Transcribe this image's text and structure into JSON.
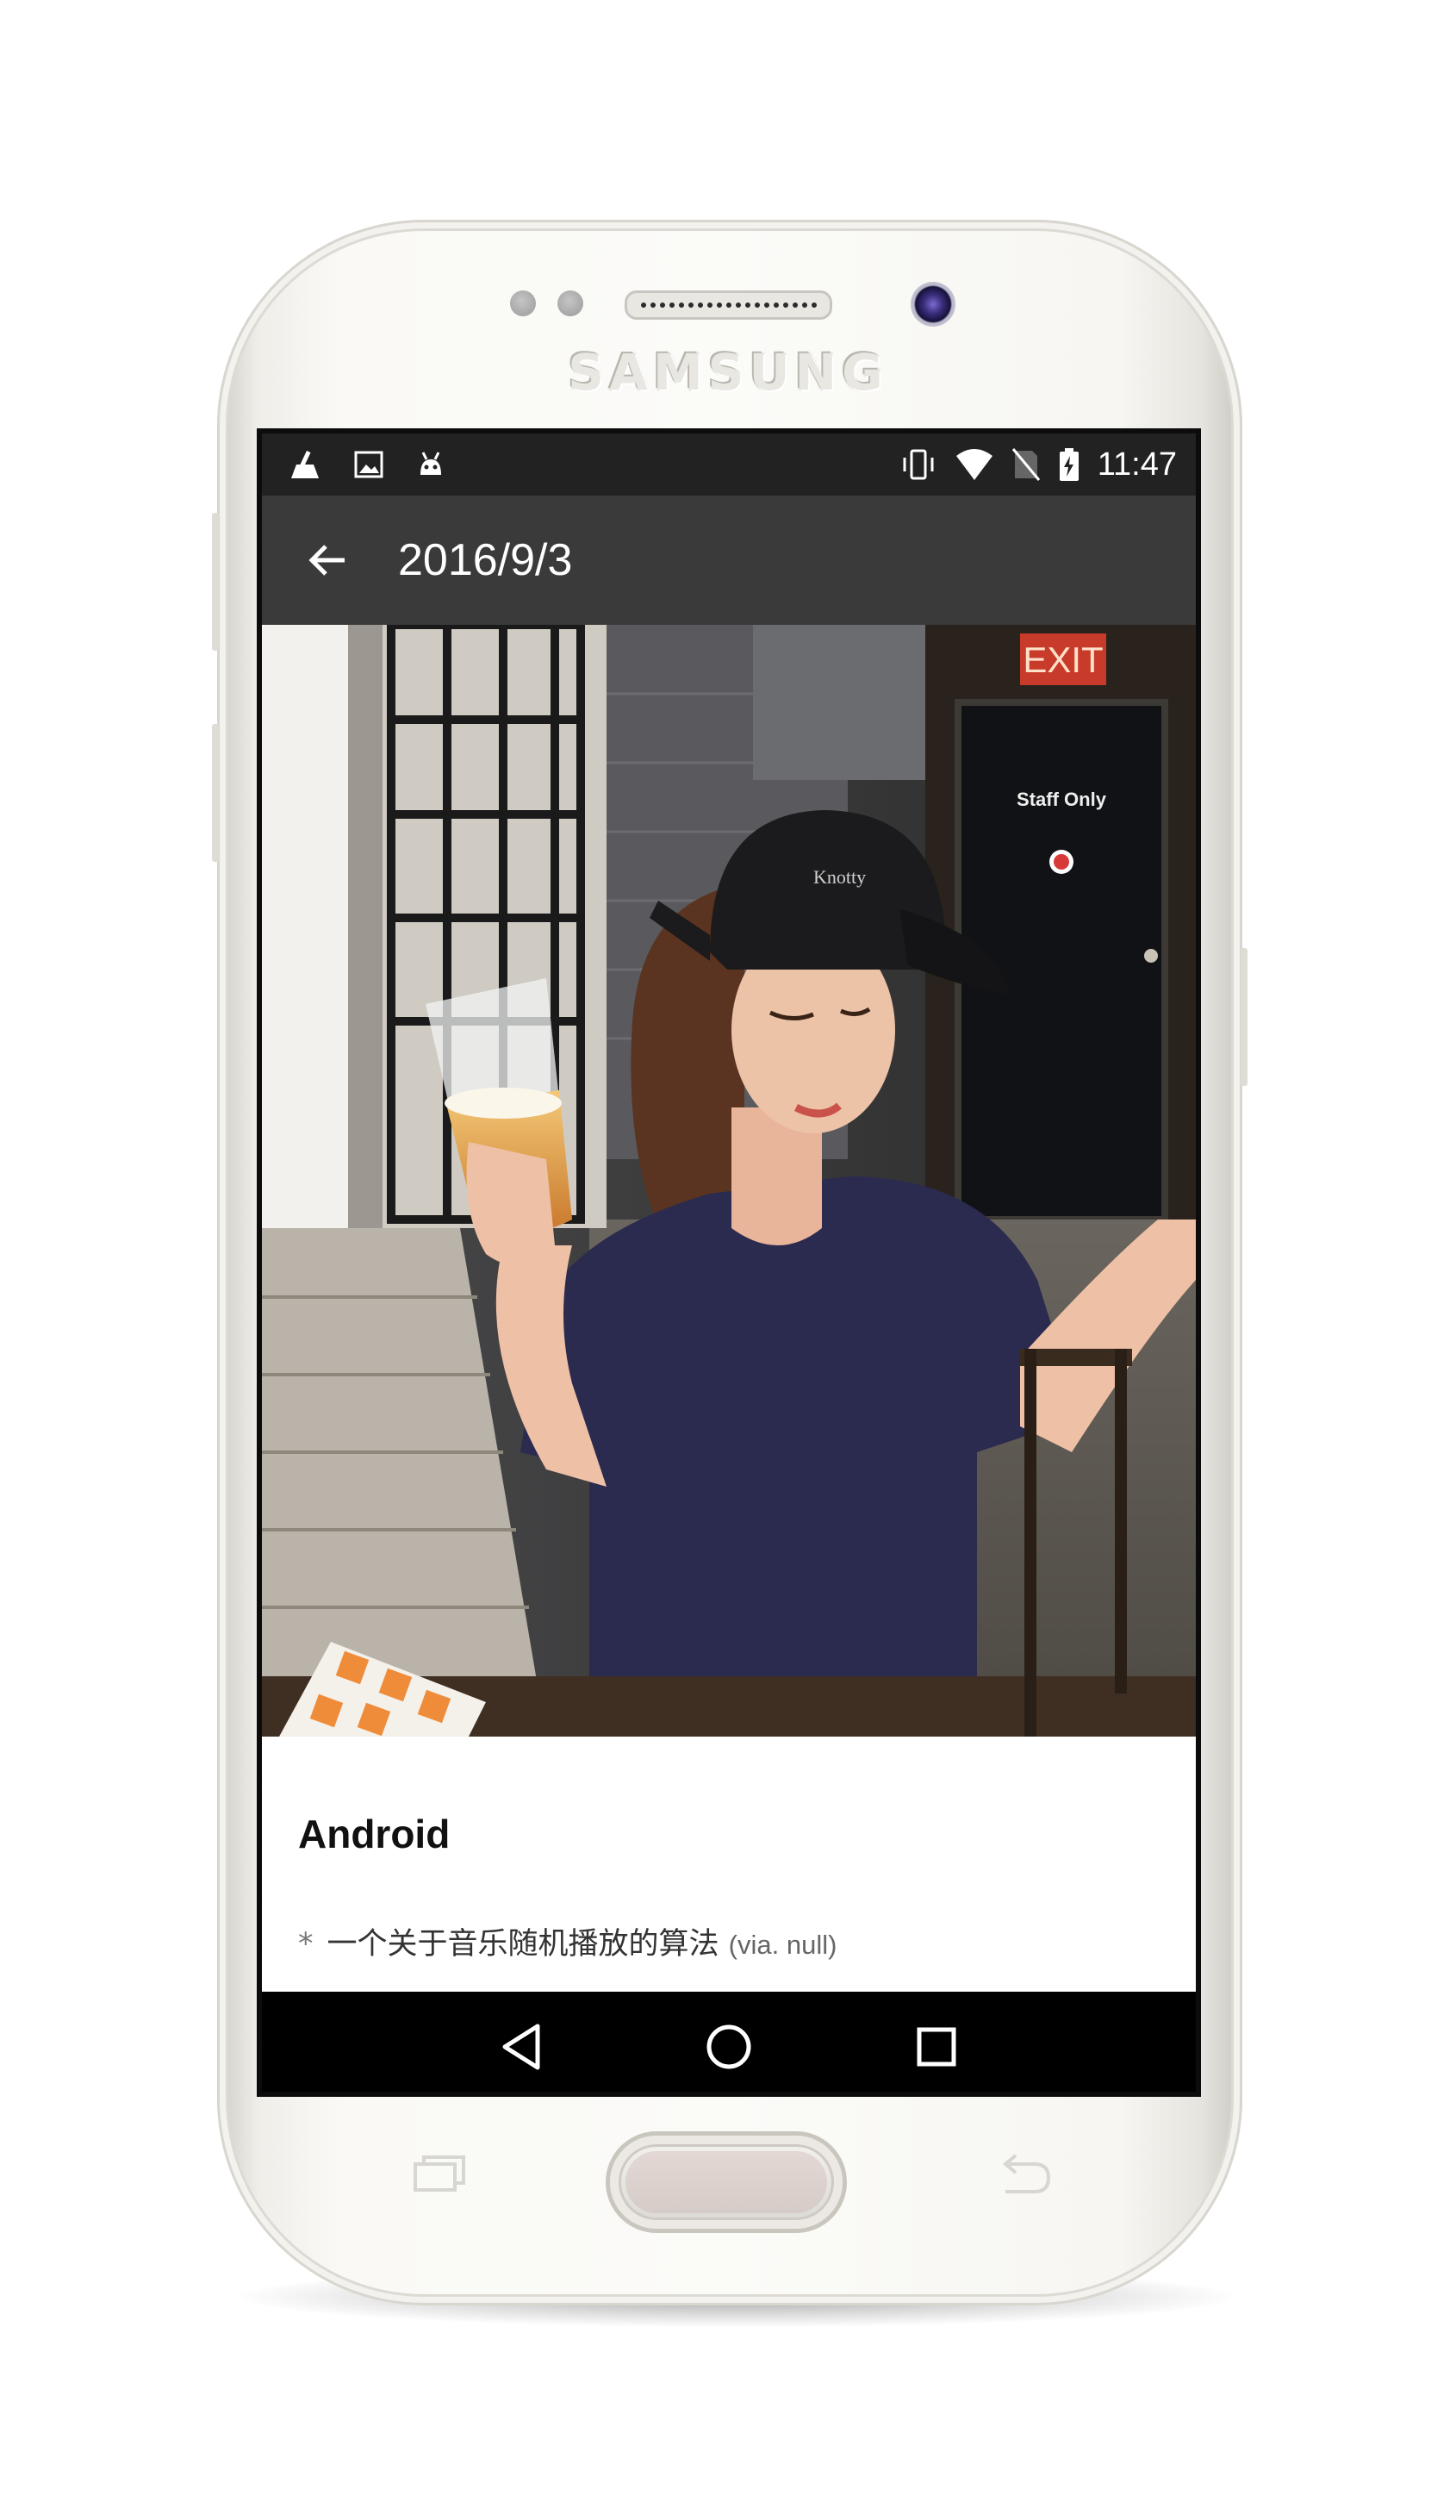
{
  "device": {
    "brand": "SAMSUNG"
  },
  "status_bar": {
    "time": "11:47",
    "left_icons": [
      "cleaner-icon",
      "image-icon",
      "android-icon"
    ],
    "right_icons": [
      "vibrate-icon",
      "wifi-icon",
      "no-sim-icon",
      "battery-charging-icon"
    ]
  },
  "toolbar": {
    "title": "2016/9/3",
    "back_icon": "arrow-back-icon"
  },
  "photo": {
    "exit_sign": "EXIT",
    "door_sign": "Staff Only"
  },
  "content": {
    "section_title": "Android",
    "articles": [
      {
        "bullet": "*",
        "title": "一个关于音乐随机播放的算法",
        "via": "(via. null)"
      }
    ]
  },
  "nav_bar": {
    "icons": [
      "back-triangle-icon",
      "home-circle-icon",
      "recents-square-icon"
    ]
  },
  "colors": {
    "toolbar": "#3a3a3a",
    "status_bar": "#222222",
    "nav_bar": "#000000"
  }
}
